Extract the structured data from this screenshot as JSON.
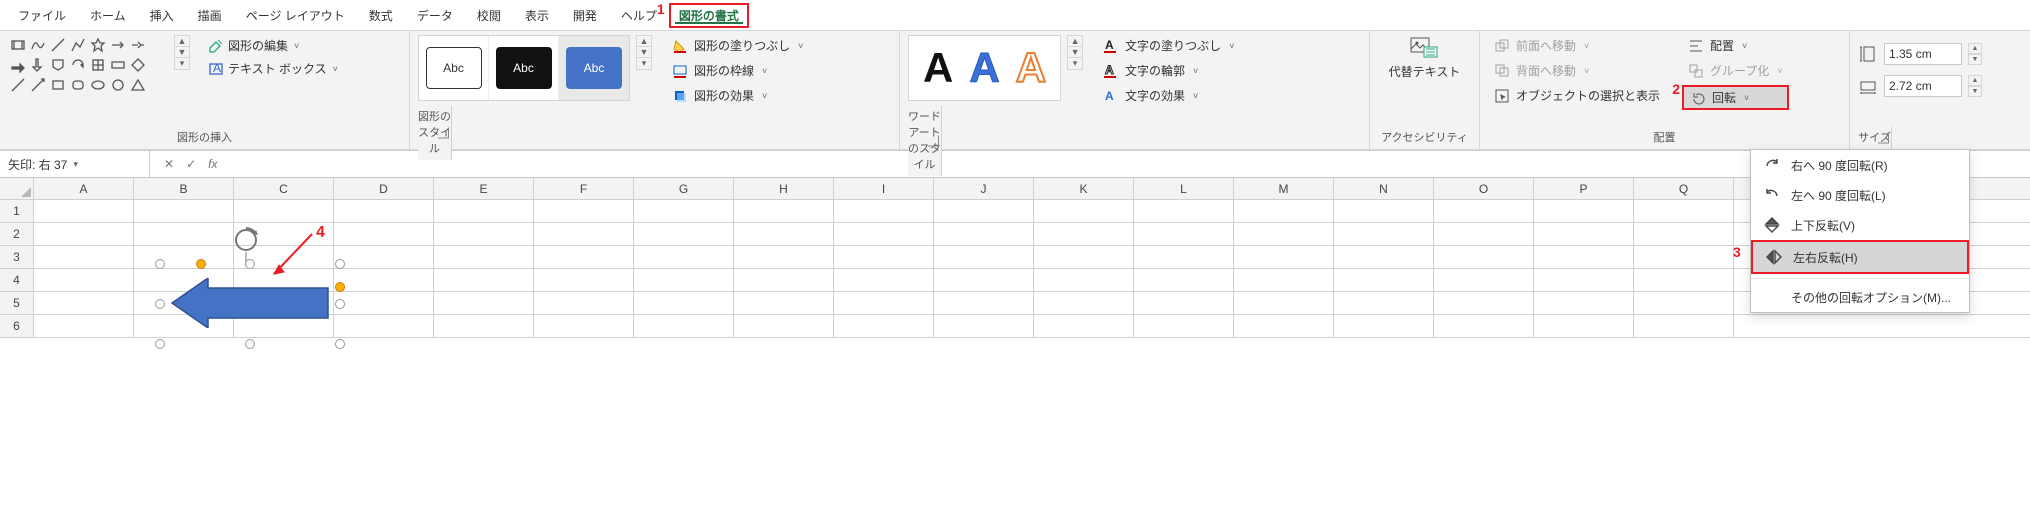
{
  "tabs": {
    "file": "ファイル",
    "home": "ホーム",
    "insert": "挿入",
    "draw": "描画",
    "layout": "ページ レイアウト",
    "formulas": "数式",
    "data": "データ",
    "review": "校閲",
    "view": "表示",
    "developer": "開発",
    "help": "ヘルプ",
    "shape_format": "図形の書式"
  },
  "ribbon": {
    "insert_shapes": {
      "label": "図形の挿入",
      "edit_shape": "図形の編集",
      "text_box": "テキスト ボックス"
    },
    "shape_styles": {
      "label": "図形のスタイル",
      "abc": "Abc",
      "fill": "図形の塗りつぶし",
      "outline": "図形の枠線",
      "effects": "図形の効果"
    },
    "wordart": {
      "label": "ワードアートのスタイル",
      "letter": "A",
      "text_fill": "文字の塗りつぶし",
      "text_outline": "文字の輪郭",
      "text_effects": "文字の効果"
    },
    "accessibility": {
      "label": "アクセシビリティ",
      "alt_text": "代替テキスト"
    },
    "arrange": {
      "label": "配置",
      "bring_forward": "前面へ移動",
      "send_backward": "背面へ移動",
      "selection_pane": "オブジェクトの選択と表示",
      "align": "配置",
      "group": "グループ化",
      "rotate": "回転"
    },
    "size": {
      "label": "サイズ",
      "h": "1.35 cm",
      "w": "2.72 cm"
    }
  },
  "rotate_menu": {
    "r90": "右へ 90 度回転(R)",
    "l90": "左へ 90 度回転(L)",
    "flipv": "上下反転(V)",
    "fliph": "左右反転(H)",
    "more": "その他の回転オプション(M)..."
  },
  "fxbar": {
    "name": "矢印: 右 37",
    "fx": "fx"
  },
  "sheet": {
    "cols": [
      "A",
      "B",
      "C",
      "D",
      "E",
      "F",
      "G",
      "H",
      "I",
      "J",
      "K",
      "L",
      "M",
      "N",
      "O",
      "P",
      "Q"
    ],
    "rows": [
      "1",
      "2",
      "3",
      "4",
      "5",
      "6"
    ]
  },
  "markers": {
    "m1": "1",
    "m2": "2",
    "m3": "3",
    "m4": "4"
  }
}
